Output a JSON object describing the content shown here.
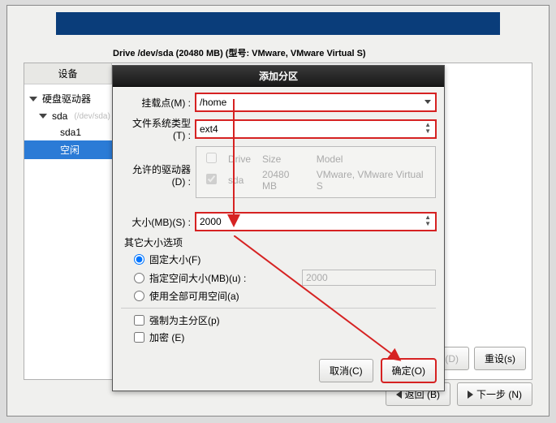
{
  "drive_title": "Drive /dev/sda (20480 MB) (型号: VMware, VMware Virtual S)",
  "sidebar": {
    "header": "设备",
    "root": "硬盘驱动器",
    "sda_label": "sda",
    "sda_sub": "(/dev/sda)",
    "sda1_label": "sda1",
    "free_label": "空闲"
  },
  "dialog": {
    "title": "添加分区",
    "mount_label": "挂载点(M) :",
    "mount_value": "/home",
    "fstype_label": "文件系统类型(T) :",
    "fstype_value": "ext4",
    "drives_label": "允许的驱动器(D) :",
    "drives_table": {
      "h_drive": "Drive",
      "h_size": "Size",
      "h_model": "Model",
      "r_drive": "sda",
      "r_size": "20480 MB",
      "r_model": "VMware, VMware Virtual S"
    },
    "size_label": "大小(MB)(S) :",
    "size_value": "2000",
    "other_size_label": "其它大小选项",
    "r_fixed": "固定大小(F)",
    "r_upto": "指定空间大小(MB)(u) :",
    "r_upto_value": "2000",
    "r_all": "使用全部可用空间(a)",
    "cb_primary": "强制为主分区(p)",
    "cb_encrypt": "加密  (E)",
    "cancel": "取消(C)",
    "ok": "确定(O)"
  },
  "footer": {
    "back": "返回 (B)",
    "next": "下一步 (N)"
  },
  "right_btns": {
    "d": "(D)",
    "reset": "重设(s)"
  }
}
